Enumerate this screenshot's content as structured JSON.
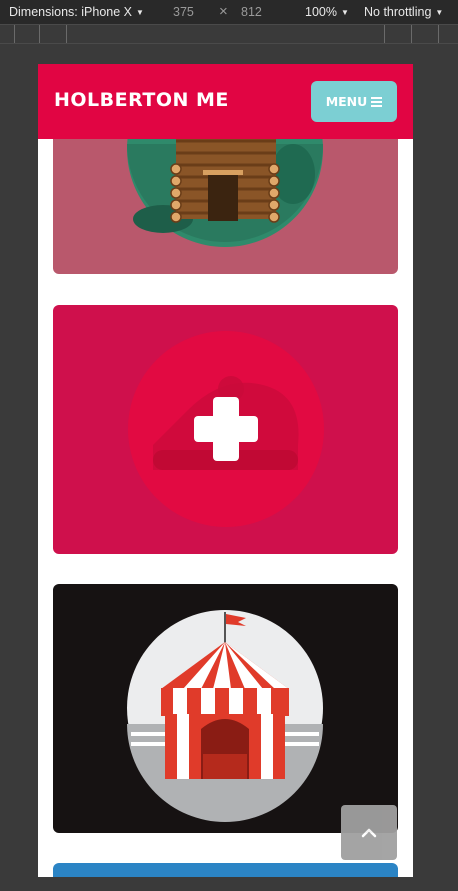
{
  "devtools": {
    "device_label": "Dimensions: iPhone X",
    "width_value": "375",
    "times_symbol": "×",
    "height_value": "812",
    "zoom_label": "100%",
    "throttle_label": "No throttling"
  },
  "site": {
    "brand": "HOLBERTON ME",
    "menu_label": "MENU"
  },
  "cards": [
    {
      "name": "log-cabin",
      "bg": "#b9586c"
    },
    {
      "name": "add-new",
      "bg": "#cf104c"
    },
    {
      "name": "circus-tent",
      "bg": "#161212"
    },
    {
      "name": "next-card",
      "bg": "#2b84c5"
    }
  ],
  "colors": {
    "header": "#e10543",
    "menu_button": "#7ccfd3"
  },
  "icons": {
    "scroll_top": "chevron-up-icon",
    "menu": "hamburger-icon",
    "add": "plus-icon"
  }
}
